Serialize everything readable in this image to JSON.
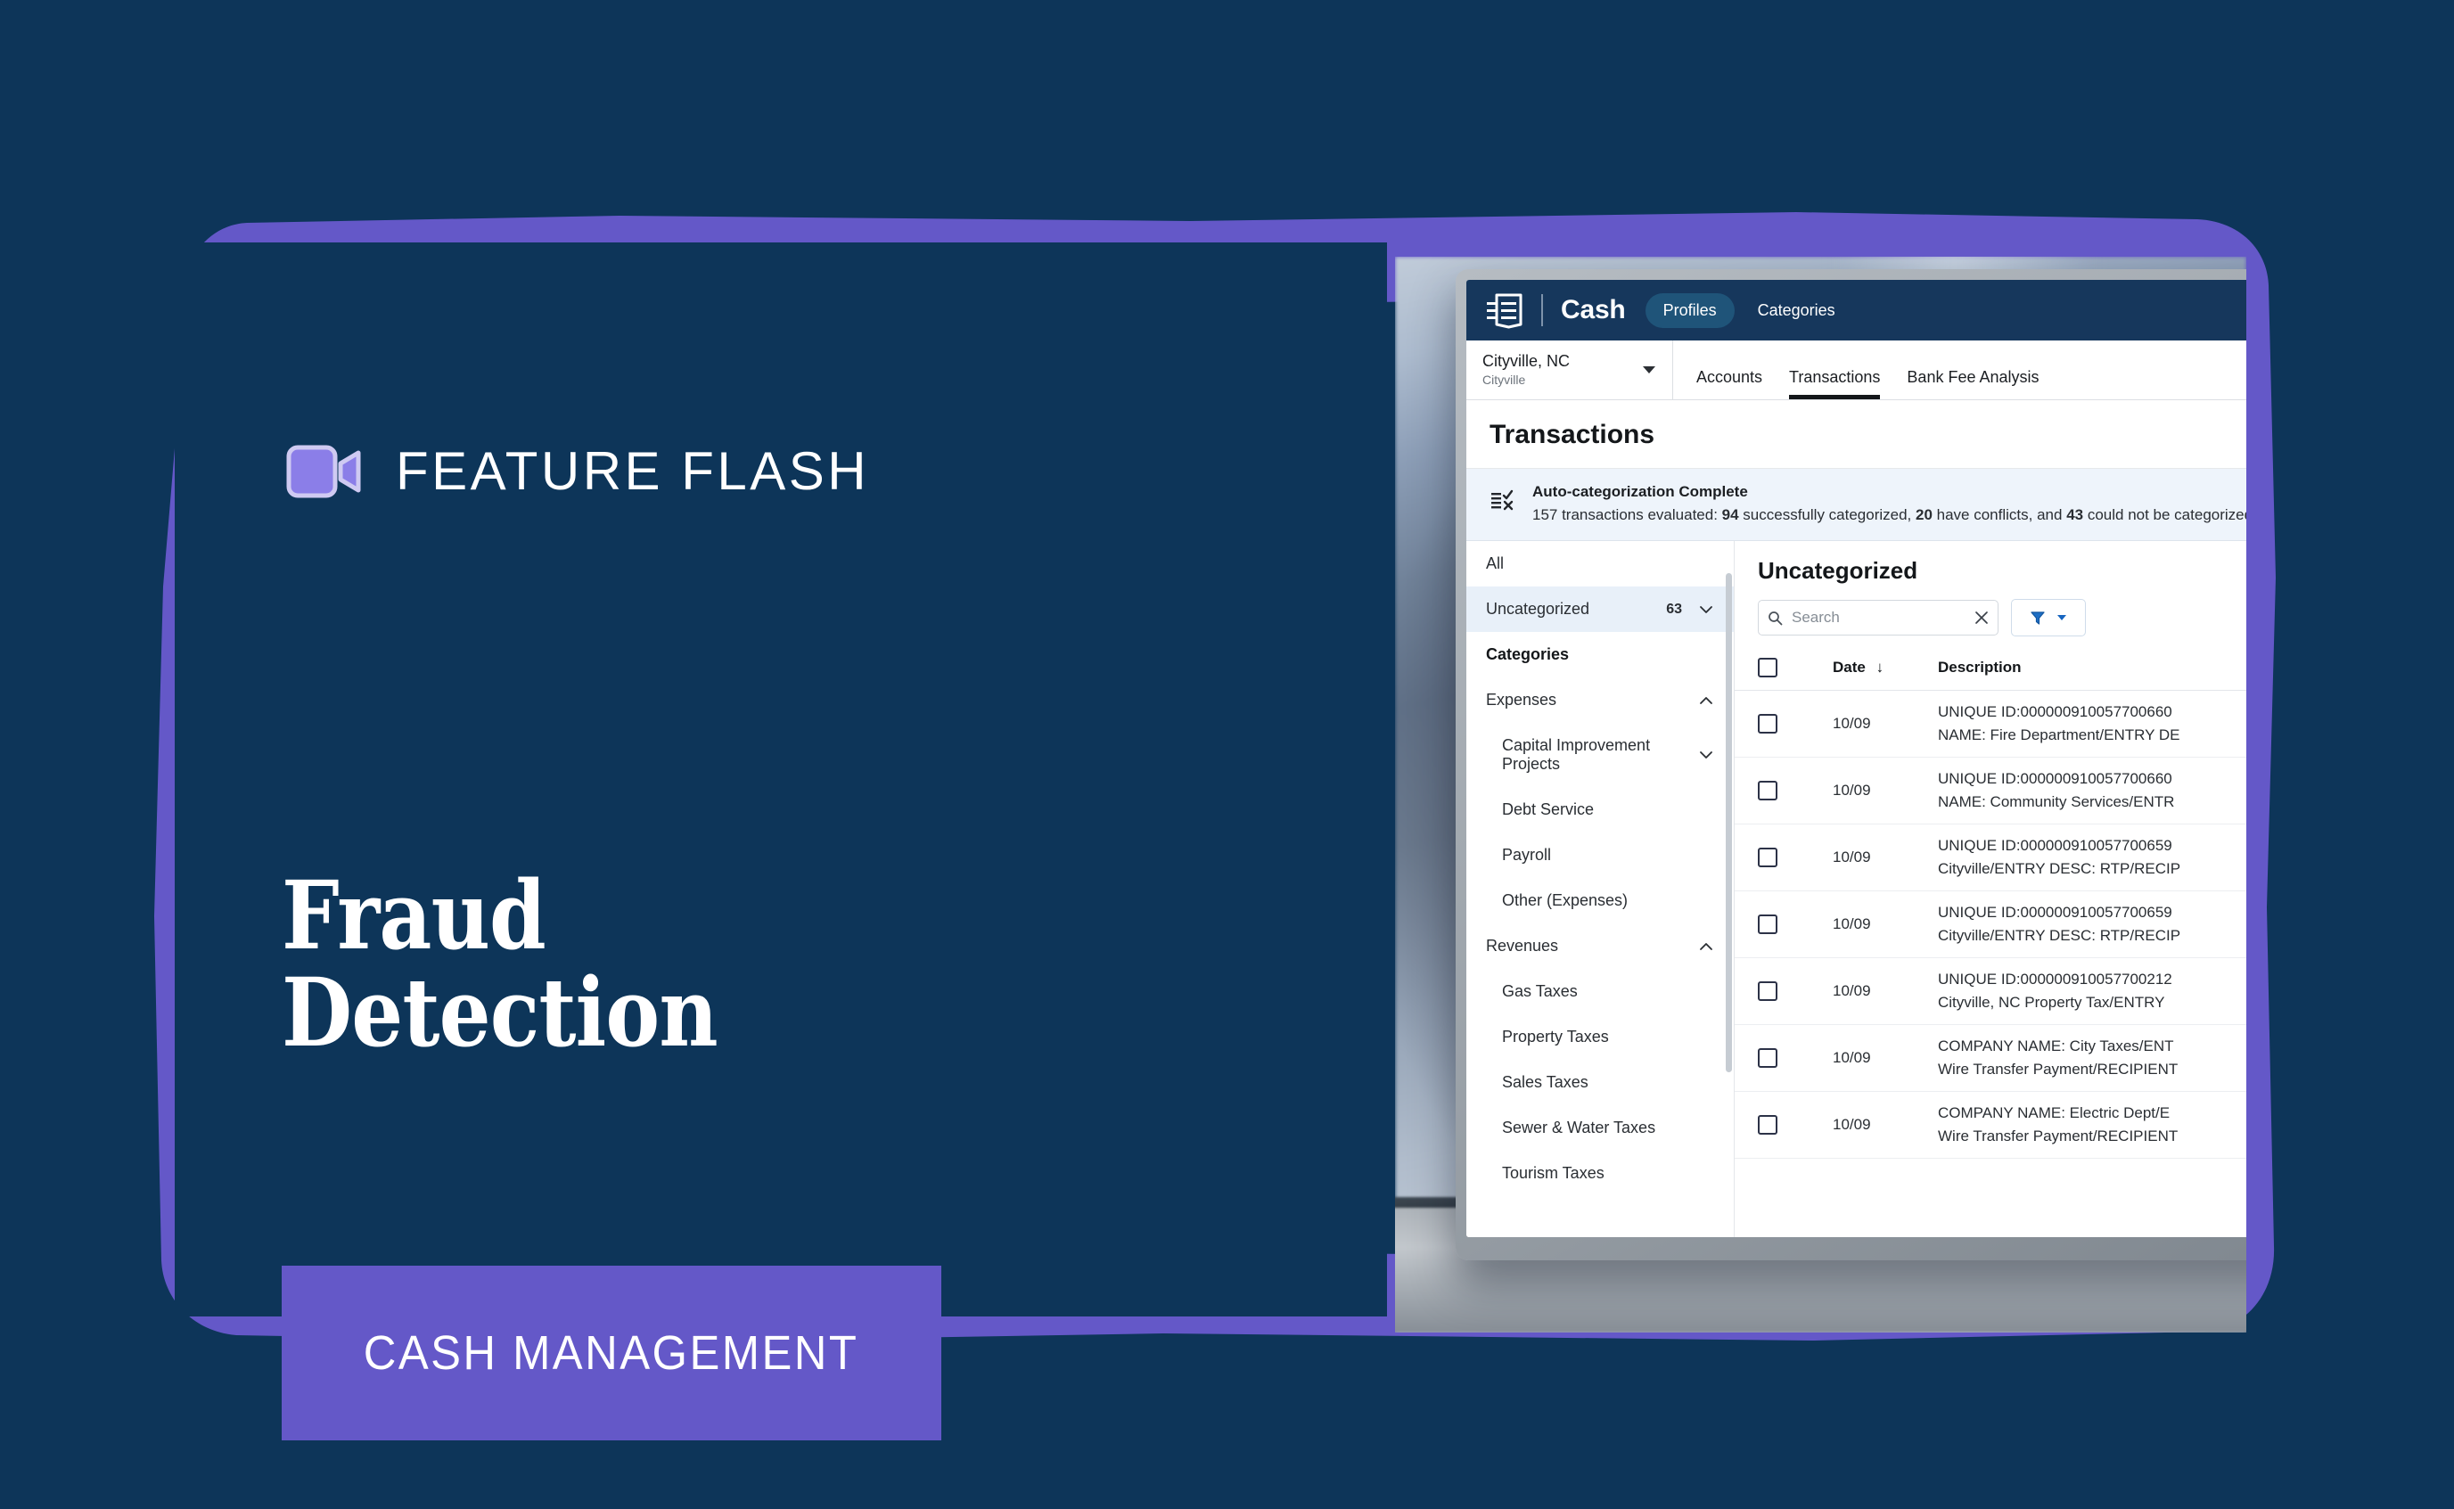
{
  "theme": {
    "bg_navy": "#0d3559",
    "accent_purple": "#6458c8",
    "app_header_navy": "#16375c",
    "banner_blue": "#eef4fb",
    "link_blue": "#1665c0"
  },
  "promo": {
    "eyebrow_icon": "video-camera-icon",
    "eyebrow": "FEATURE FLASH",
    "headline_line1": "Fraud",
    "headline_line2": "Detection",
    "cta_label": "CASH MANAGEMENT"
  },
  "app": {
    "topbar": {
      "logo_icon": "ledger-book-icon",
      "product_name": "Cash",
      "nav": [
        {
          "label": "Profiles",
          "active": true
        },
        {
          "label": "Categories",
          "active": false
        }
      ]
    },
    "context": {
      "profile_name": "Cityville, NC",
      "profile_sub": "Cityville",
      "profile_caret_icon": "chevron-down-icon",
      "tabs": [
        {
          "label": "Accounts",
          "active": false
        },
        {
          "label": "Transactions",
          "active": true
        },
        {
          "label": "Bank Fee Analysis",
          "active": false
        }
      ]
    },
    "page_title": "Transactions",
    "banner": {
      "icon": "auto-categorize-icon",
      "title": "Auto-categorization Complete",
      "message_prefix": "157 transactions evaluated: ",
      "success_count": "94",
      "message_mid1": " successfully categorized, ",
      "conflict_count": "20",
      "message_mid2": " have conflicts, and ",
      "failed_count": "43",
      "message_suffix": " could not be categorized"
    },
    "sidebar": {
      "all_label": "All",
      "uncategorized": {
        "label": "Uncategorized",
        "count": "63",
        "chevron_icon": "chevron-down-icon",
        "selected": true
      },
      "categories_heading": "Categories",
      "groups": [
        {
          "label": "Expenses",
          "chevron_icon": "chevron-up-icon",
          "items": [
            {
              "label": "Capital Improvement Projects",
              "chevron_icon": "chevron-down-icon"
            },
            {
              "label": "Debt Service"
            },
            {
              "label": "Payroll"
            },
            {
              "label": "Other (Expenses)"
            }
          ]
        },
        {
          "label": "Revenues",
          "chevron_icon": "chevron-up-icon",
          "items": [
            {
              "label": "Gas Taxes"
            },
            {
              "label": "Property Taxes"
            },
            {
              "label": "Sales Taxes"
            },
            {
              "label": "Sewer & Water Taxes"
            },
            {
              "label": "Tourism Taxes"
            }
          ]
        }
      ]
    },
    "list": {
      "title": "Uncategorized",
      "search_placeholder": "Search",
      "search_value": "",
      "search_icon": "search-icon",
      "clear_icon": "close-icon",
      "filter_icon": "filter-funnel-icon",
      "filter_caret_icon": "caret-down-icon",
      "columns": {
        "select_all": "select-all-checkbox",
        "date": "Date",
        "date_sort_icon": "arrow-down-icon",
        "description": "Description"
      },
      "rows": [
        {
          "date": "10/09",
          "desc_line1": "UNIQUE ID:000000910057700660",
          "desc_line2": "NAME: Fire Department/ENTRY DE"
        },
        {
          "date": "10/09",
          "desc_line1": "UNIQUE ID:000000910057700660",
          "desc_line2": "NAME: Community Services/ENTR"
        },
        {
          "date": "10/09",
          "desc_line1": "UNIQUE ID:000000910057700659",
          "desc_line2": "Cityville/ENTRY DESC: RTP/RECIP"
        },
        {
          "date": "10/09",
          "desc_line1": "UNIQUE ID:000000910057700659",
          "desc_line2": "Cityville/ENTRY DESC: RTP/RECIP"
        },
        {
          "date": "10/09",
          "desc_line1": "UNIQUE ID:000000910057700212",
          "desc_line2": "Cityville, NC Property Tax/ENTRY"
        },
        {
          "date": "10/09",
          "desc_line1": "COMPANY NAME: City Taxes/ENT",
          "desc_line2": "Wire Transfer Payment/RECIPIENT"
        },
        {
          "date": "10/09",
          "desc_line1": "COMPANY NAME: Electric Dept/E",
          "desc_line2": "Wire Transfer Payment/RECIPIENT"
        }
      ]
    },
    "cursor_icon": "pointing-hand-cursor"
  }
}
